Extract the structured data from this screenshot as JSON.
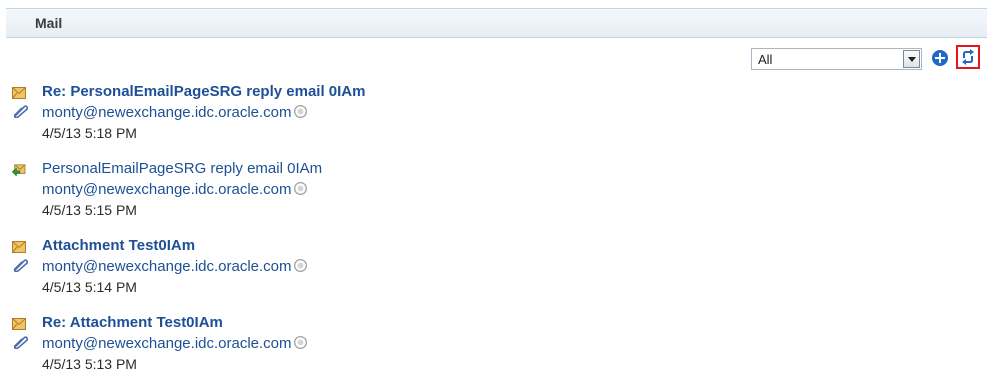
{
  "panel": {
    "title": "Mail"
  },
  "toolbar": {
    "filter_value": "All"
  },
  "mails": [
    {
      "subject": "Re: PersonalEmailPageSRG reply email 0IAm",
      "sender": "monty@newexchange.idc.oracle.com",
      "date": "4/5/13 5:18 PM",
      "unread": true,
      "icon": "envelope-icon",
      "has_attachment": true
    },
    {
      "subject": "PersonalEmailPageSRG reply email 0IAm",
      "sender": "monty@newexchange.idc.oracle.com",
      "date": "4/5/13 5:15 PM",
      "unread": false,
      "icon": "reply-mail-icon",
      "has_attachment": false
    },
    {
      "subject": "Attachment Test0IAm",
      "sender": "monty@newexchange.idc.oracle.com",
      "date": "4/5/13 5:14 PM",
      "unread": true,
      "icon": "envelope-icon",
      "has_attachment": true
    },
    {
      "subject": "Re: Attachment Test0IAm",
      "sender": "monty@newexchange.idc.oracle.com",
      "date": "4/5/13 5:13 PM",
      "unread": true,
      "icon": "envelope-icon",
      "has_attachment": true
    }
  ],
  "colors": {
    "link": "#1e5096",
    "header_bg": "#e6eef4",
    "highlight": "#e0161b",
    "accent": "#1f68c4"
  }
}
